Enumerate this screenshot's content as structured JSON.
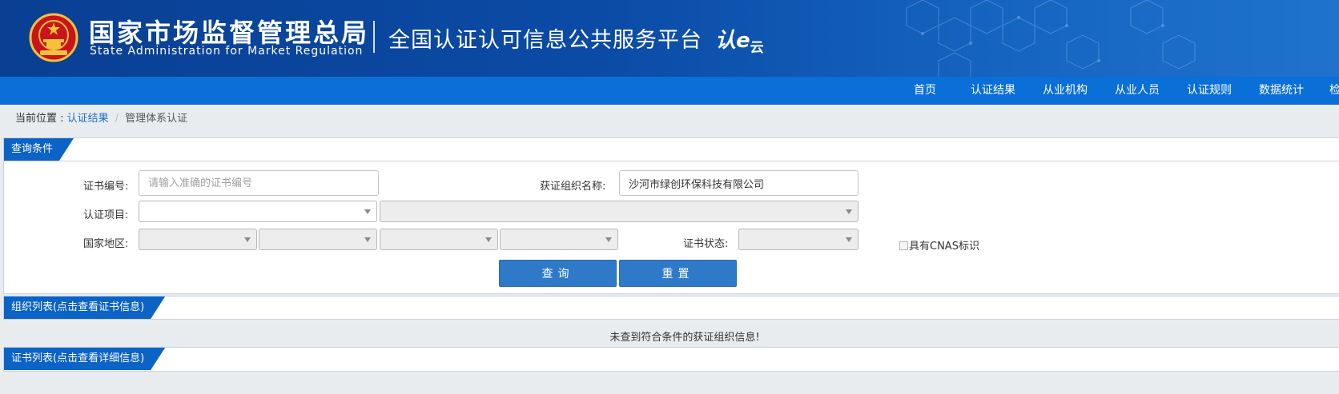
{
  "header": {
    "title_cn": "国家市场监督管理总局",
    "title_en": "State Administration  for  Market Regulation",
    "subtitle": "全国认证认可信息公共服务平台",
    "logo_main": "认e",
    "logo_small": "云",
    "colors": {
      "banner": "#0b4ba6",
      "nav": "#0a6fd6",
      "tab": "#0b63c6",
      "button": "#2f7ac8"
    }
  },
  "nav": {
    "items": [
      {
        "label": "首页"
      },
      {
        "label": "认证结果"
      },
      {
        "label": "从业机构"
      },
      {
        "label": "从业人员"
      },
      {
        "label": "认证规则"
      },
      {
        "label": "数据统计"
      },
      {
        "label": "检"
      }
    ]
  },
  "breadcrumb": {
    "prefix": "当前位置 : ",
    "link": "认证结果",
    "separator": "/",
    "current": "管理体系认证"
  },
  "query": {
    "tab_label": "查询条件",
    "cert_no_label": "证书编号:",
    "cert_no_placeholder": "请输入准确的证书编号",
    "cert_no_value": "",
    "org_name_label": "获证组织名称:",
    "org_name_value": "沙河市绿创环保科技有限公司",
    "project_label": "认证项目:",
    "region_label": "国家地区:",
    "status_label": "证书状态:",
    "cnas_label": "具有CNAS标识",
    "search_button": "查询",
    "reset_button": "重置"
  },
  "org_list": {
    "tab_label": "组织列表(点击查看证书信息)",
    "empty_message": "未查到符合条件的获证组织信息!"
  },
  "cert_list": {
    "tab_label": "证书列表(点击查看详细信息)"
  }
}
